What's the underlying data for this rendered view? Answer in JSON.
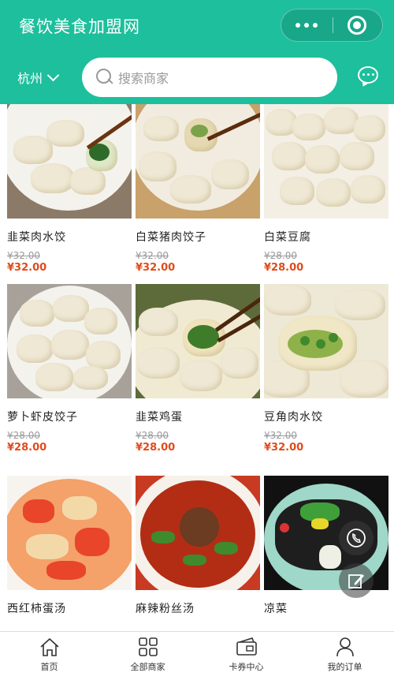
{
  "header": {
    "title": "餐饮美食加盟网",
    "city": "杭州",
    "search_placeholder": "搜索商家",
    "bg_color": "#1dbf9c"
  },
  "products": [
    {
      "name": "韭菜肉水饺",
      "old_price": "¥32.00",
      "price": "¥32.00"
    },
    {
      "name": "白菜猪肉饺子",
      "old_price": "¥32.00",
      "price": "¥32.00"
    },
    {
      "name": "白菜豆腐",
      "old_price": "¥28.00",
      "price": "¥28.00"
    },
    {
      "name": "萝卜虾皮饺子",
      "old_price": "¥28.00",
      "price": "¥28.00"
    },
    {
      "name": "韭菜鸡蛋",
      "old_price": "¥28.00",
      "price": "¥28.00"
    },
    {
      "name": "豆角肉水饺",
      "old_price": "¥32.00",
      "price": "¥32.00"
    },
    {
      "name": "西红柿蛋汤",
      "old_price": "",
      "price": ""
    },
    {
      "name": "麻辣粉丝汤",
      "old_price": "",
      "price": ""
    },
    {
      "name": "凉菜",
      "old_price": "",
      "price": ""
    }
  ],
  "tabbar": [
    {
      "label": "首页",
      "icon": "home-icon"
    },
    {
      "label": "全部商家",
      "icon": "grid-icon"
    },
    {
      "label": "卡券中心",
      "icon": "ticket-icon"
    },
    {
      "label": "我的订单",
      "icon": "user-icon"
    }
  ],
  "colors": {
    "accent": "#1dbf9c",
    "price": "#e14b1b"
  }
}
